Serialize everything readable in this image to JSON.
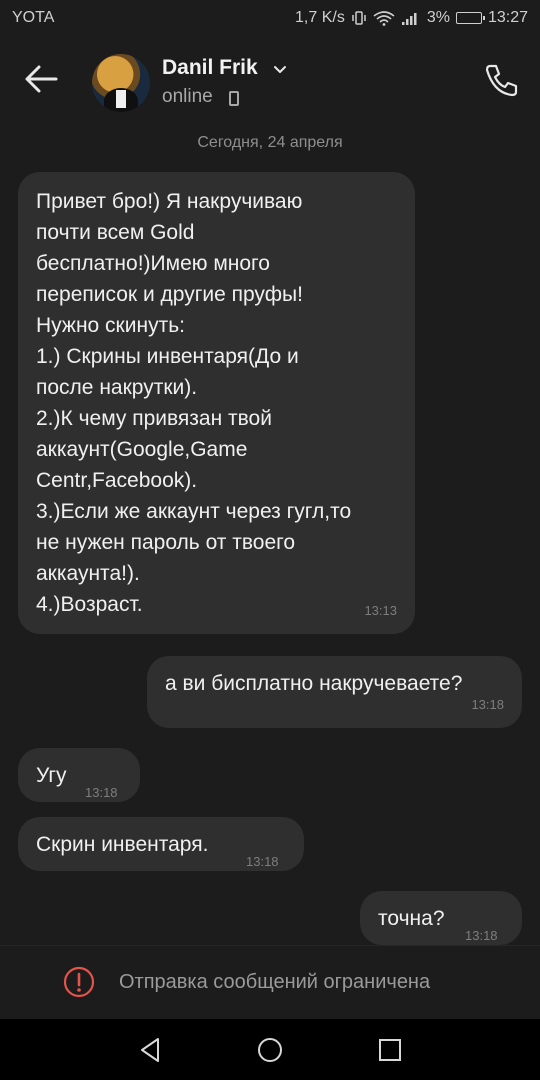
{
  "status_bar": {
    "carrier": "YOTA",
    "speed": "1,7 K/s",
    "battery": "3%",
    "time": "13:27"
  },
  "header": {
    "contact_name": "Danil Frik",
    "contact_status": "online"
  },
  "chat": {
    "date_separator": "Сегодня, 24 апреля",
    "messages": [
      {
        "direction": "incoming",
        "text": "Привет бро!) Я накручиваю\nпочти всем Gold\nбесплатно!)Имею много\nпереписок и другие пруфы!\nНужно скинуть:\n1.) Скрины инвентаря(До и\nпосле накрутки).\n2.)К чему привязан твой\nаккаунт(Google,Game\nCentr,Facebook).\n3.)Если же аккаунт через гугл,то\nне нужен пароль от твоего\nаккаунта!).\n4.)Возраст.",
        "time": "13:13"
      },
      {
        "direction": "outgoing",
        "text": "а ви бисплатно накручеваете?",
        "time": "13:18"
      },
      {
        "direction": "incoming",
        "text": "Угу",
        "time": "13:18"
      },
      {
        "direction": "incoming",
        "text": "Скрин инвентаря.",
        "time": "13:18"
      },
      {
        "direction": "outgoing",
        "text": "точна?",
        "time": "13:18"
      }
    ]
  },
  "restriction": {
    "text": "Отправка сообщений ограничена",
    "icon": "alert-circle-icon",
    "color": "#e5534b"
  },
  "nav_bar": {
    "icons": [
      "back-triangle-icon",
      "home-circle-icon",
      "recents-square-icon"
    ]
  }
}
